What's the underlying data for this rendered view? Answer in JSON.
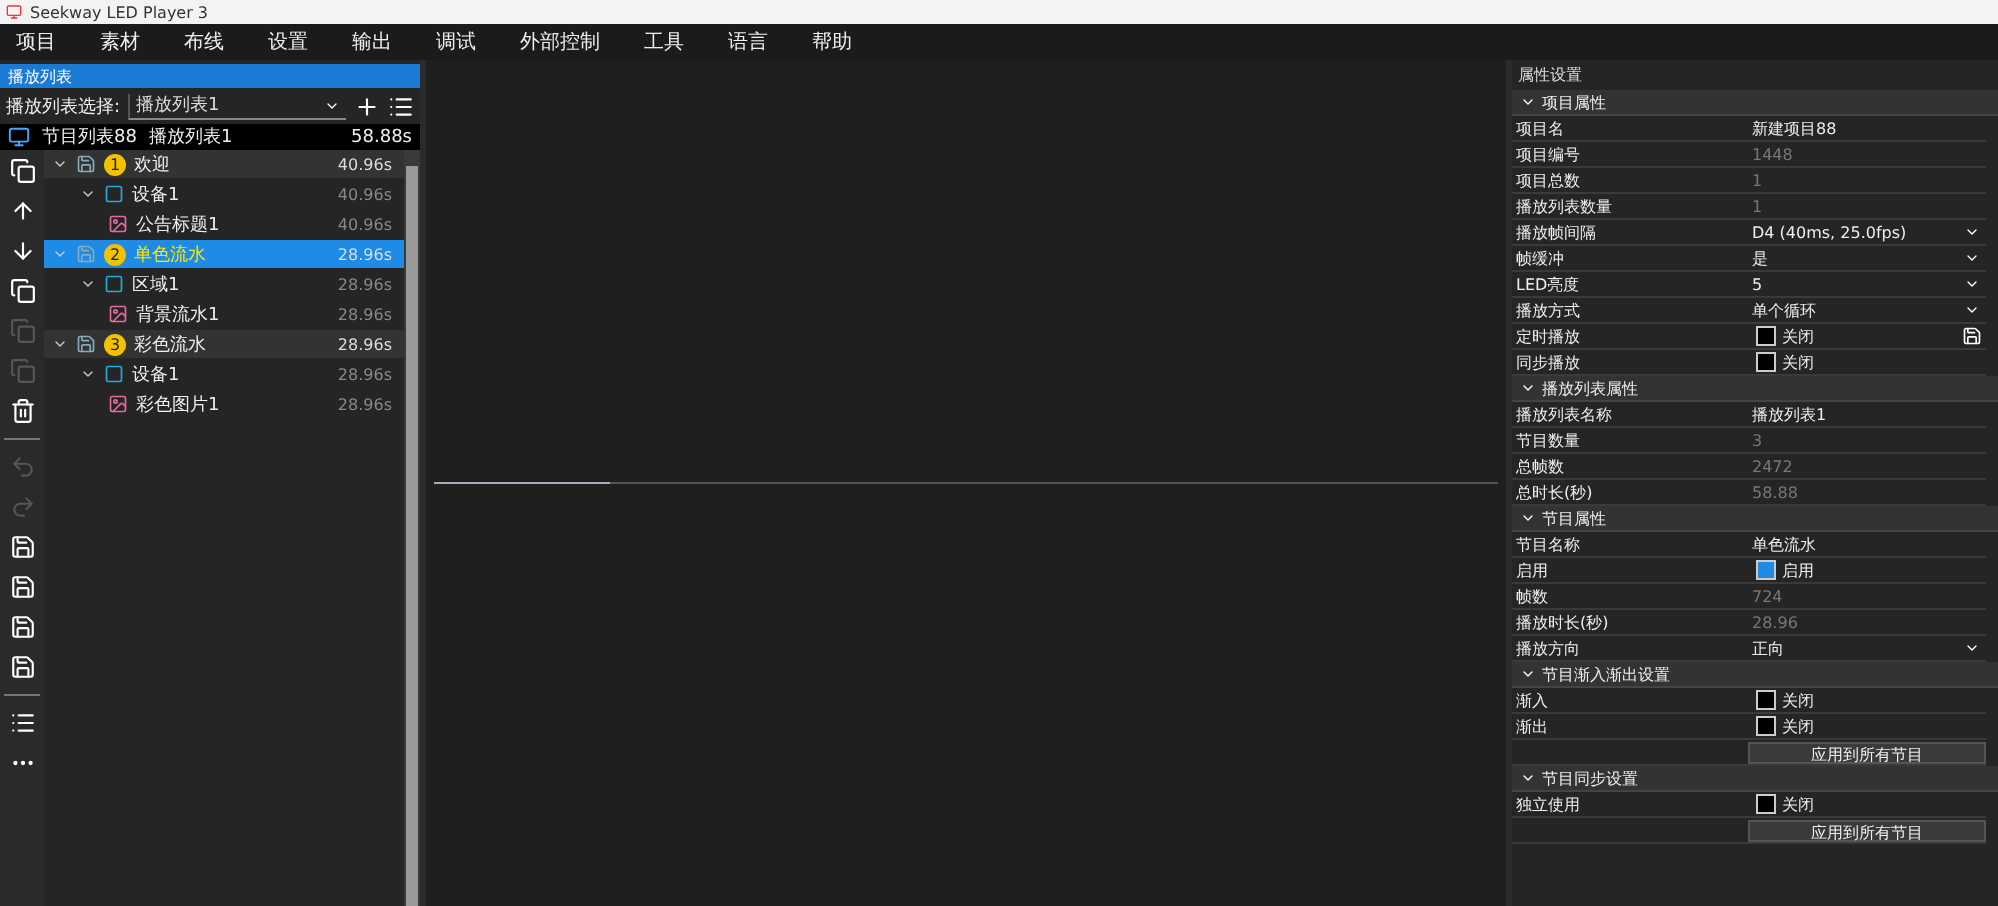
{
  "window": {
    "title": "Seekway LED Player 3"
  },
  "menu": [
    "项目",
    "素材",
    "布线",
    "设置",
    "输出",
    "调试",
    "外部控制",
    "工具",
    "语言",
    "帮助"
  ],
  "playlist_panel": {
    "title": "播放列表",
    "selector_label": "播放列表选择:",
    "selector_value": "播放列表1",
    "summary": {
      "name": "节目列表88",
      "playlist": "播放列表1",
      "duration": "58.88s"
    },
    "items": [
      {
        "number": "1",
        "name": "欢迎",
        "duration": "40.96s",
        "selected": false,
        "children": [
          {
            "name": "设备1",
            "duration": "40.96s",
            "children": [
              {
                "name": "公告标题1",
                "duration": "40.96s"
              }
            ]
          }
        ]
      },
      {
        "number": "2",
        "name": "单色流水",
        "duration": "28.96s",
        "selected": true,
        "children": [
          {
            "name": "区域1",
            "duration": "28.96s",
            "children": [
              {
                "name": "背景流水1",
                "duration": "28.96s"
              }
            ]
          }
        ]
      },
      {
        "number": "3",
        "name": "彩色流水",
        "duration": "28.96s",
        "selected": false,
        "children": [
          {
            "name": "设备1",
            "duration": "28.96s",
            "children": [
              {
                "name": "彩色图片1",
                "duration": "28.96s"
              }
            ]
          }
        ]
      }
    ]
  },
  "properties": {
    "title": "属性设置",
    "sections": [
      {
        "title": "项目属性",
        "rows": [
          {
            "kind": "text",
            "label": "项目名",
            "value": "新建项目88"
          },
          {
            "kind": "dim",
            "label": "项目编号",
            "value": "1448"
          },
          {
            "kind": "dim",
            "label": "项目总数",
            "value": "1"
          },
          {
            "kind": "dim",
            "label": "播放列表数量",
            "value": "1"
          },
          {
            "kind": "select",
            "label": "播放帧间隔",
            "value": "D4 (40ms, 25.0fps)"
          },
          {
            "kind": "select",
            "label": "帧缓冲",
            "value": "是"
          },
          {
            "kind": "select",
            "label": "LED亮度",
            "value": "5"
          },
          {
            "kind": "select",
            "label": "播放方式",
            "value": "单个循环"
          },
          {
            "kind": "check",
            "label": "定时播放",
            "value": "关闭",
            "checked": false,
            "action": true
          },
          {
            "kind": "check",
            "label": "同步播放",
            "value": "关闭",
            "checked": false
          }
        ]
      },
      {
        "title": "播放列表属性",
        "rows": [
          {
            "kind": "text",
            "label": "播放列表名称",
            "value": "播放列表1"
          },
          {
            "kind": "dim",
            "label": "节目数量",
            "value": "3"
          },
          {
            "kind": "dim",
            "label": "总帧数",
            "value": "2472"
          },
          {
            "kind": "dim",
            "label": "总时长(秒)",
            "value": "58.88"
          }
        ]
      },
      {
        "title": "节目属性",
        "rows": [
          {
            "kind": "text",
            "label": "节目名称",
            "value": "单色流水"
          },
          {
            "kind": "check",
            "label": "启用",
            "value": "启用",
            "checked": true
          },
          {
            "kind": "dim",
            "label": "帧数",
            "value": "724"
          },
          {
            "kind": "dim",
            "label": "播放时长(秒)",
            "value": "28.96"
          },
          {
            "kind": "select",
            "label": "播放方向",
            "value": "正向"
          }
        ]
      },
      {
        "title": "节目渐入渐出设置",
        "rows": [
          {
            "kind": "check",
            "label": "渐入",
            "value": "关闭",
            "checked": false
          },
          {
            "kind": "check",
            "label": "渐出",
            "value": "关闭",
            "checked": false
          },
          {
            "kind": "button",
            "label": "",
            "value": "应用到所有节目"
          }
        ]
      },
      {
        "title": "节目同步设置",
        "rows": [
          {
            "kind": "check",
            "label": "独立使用",
            "value": "关闭",
            "checked": false
          },
          {
            "kind": "button",
            "label": "",
            "value": "应用到所有节目"
          }
        ]
      }
    ]
  }
}
